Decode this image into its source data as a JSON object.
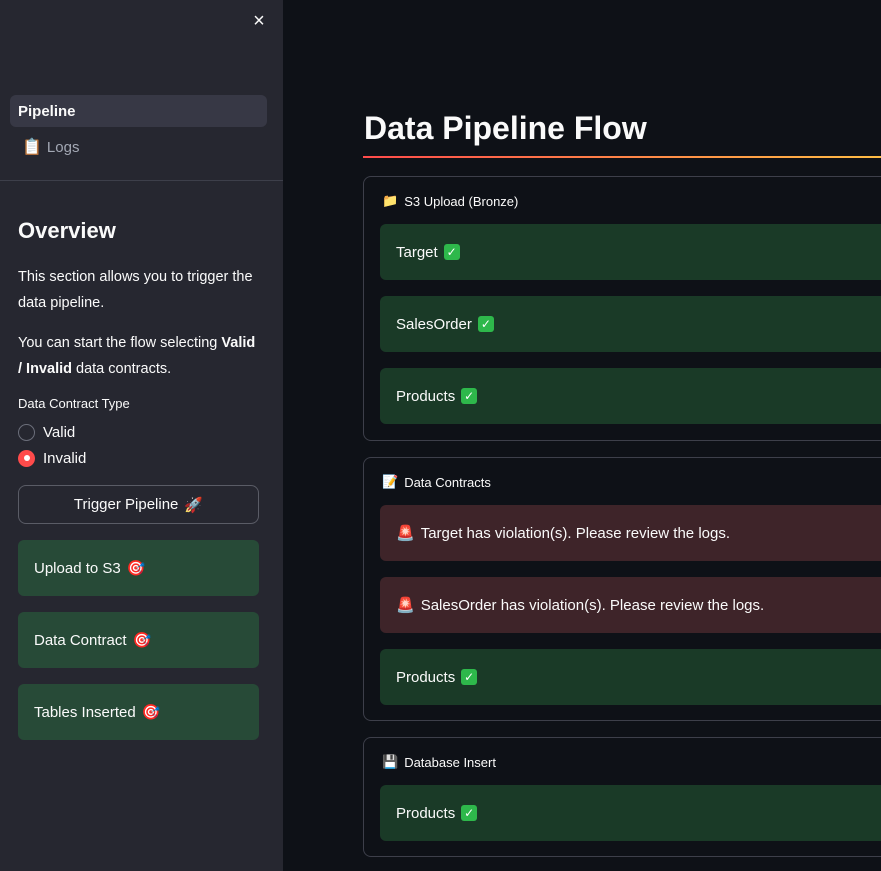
{
  "sidebar": {
    "close_icon": "×",
    "nav": [
      {
        "label": "Pipeline",
        "icon": "",
        "active": true
      },
      {
        "label": "Logs",
        "icon": "📋",
        "active": false
      }
    ],
    "overview_title": "Overview",
    "para1": "This section allows you to trigger the data pipeline.",
    "para2_prefix": "You can start the flow selecting ",
    "para2_bold": "Valid / Invalid",
    "para2_suffix": " data contracts.",
    "radio_label": "Data Contract Type",
    "radio_options": [
      {
        "label": "Valid",
        "checked": false
      },
      {
        "label": "Invalid",
        "checked": true
      }
    ],
    "trigger_button": "Trigger Pipeline",
    "trigger_icon": "🚀",
    "steps": [
      {
        "label": "Upload to S3",
        "icon": "🎯"
      },
      {
        "label": "Data Contract",
        "icon": "🎯"
      },
      {
        "label": "Tables Inserted",
        "icon": "🎯"
      }
    ]
  },
  "main": {
    "title": "Data Pipeline Flow",
    "panels": [
      {
        "header": "S3 Upload (Bronze)",
        "icon": "📁",
        "items": [
          {
            "text": "Target",
            "status": "success"
          },
          {
            "text": "SalesOrder",
            "status": "success"
          },
          {
            "text": "Products",
            "status": "success"
          }
        ]
      },
      {
        "header": "Data Contracts",
        "icon": "📝",
        "items": [
          {
            "text": "Target has violation(s). Please review the logs.",
            "status": "error"
          },
          {
            "text": "SalesOrder has violation(s). Please review the logs.",
            "status": "error"
          },
          {
            "text": "Products",
            "status": "success"
          }
        ]
      },
      {
        "header": "Database Insert",
        "icon": "💾",
        "items": [
          {
            "text": "Products",
            "status": "success"
          }
        ]
      }
    ]
  },
  "colors": {
    "background": "#0e1117",
    "sidebar": "#262730",
    "success_bg": "#1a3a27",
    "error_bg": "#3e2429",
    "accent": "#ff4b4b"
  }
}
